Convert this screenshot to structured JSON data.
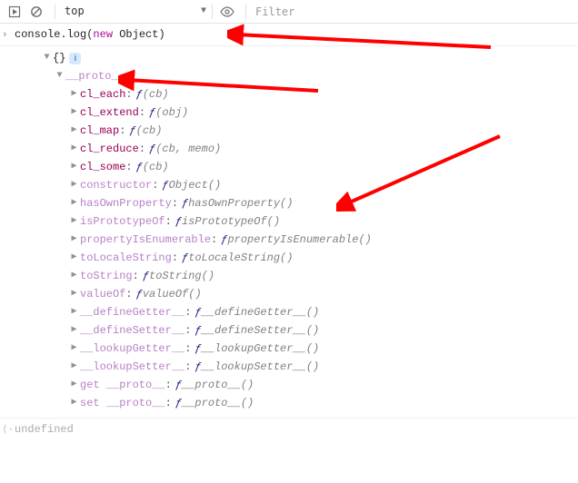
{
  "toolbar": {
    "context": "top",
    "filter_placeholder": "Filter"
  },
  "console": {
    "input_prefix": "console.log(",
    "input_kw": "new",
    "input_suffix": " Object)",
    "result_braces": "{}",
    "info_badge": "i",
    "return_value": "undefined"
  },
  "proto_label": "__proto__",
  "props": [
    {
      "name": "cl_each",
      "sig": "(cb)",
      "faded": false
    },
    {
      "name": "cl_extend",
      "sig": "(obj)",
      "faded": false
    },
    {
      "name": "cl_map",
      "sig": "(cb)",
      "faded": false
    },
    {
      "name": "cl_reduce",
      "sig": "(cb, memo)",
      "faded": false
    },
    {
      "name": "cl_some",
      "sig": "(cb)",
      "faded": false
    },
    {
      "name": "constructor",
      "sig": "Object()",
      "faded": true
    },
    {
      "name": "hasOwnProperty",
      "sig": "hasOwnProperty()",
      "faded": true
    },
    {
      "name": "isPrototypeOf",
      "sig": "isPrototypeOf()",
      "faded": true
    },
    {
      "name": "propertyIsEnumerable",
      "sig": "propertyIsEnumerable()",
      "faded": true
    },
    {
      "name": "toLocaleString",
      "sig": "toLocaleString()",
      "faded": true
    },
    {
      "name": "toString",
      "sig": "toString()",
      "faded": true
    },
    {
      "name": "valueOf",
      "sig": "valueOf()",
      "faded": true
    },
    {
      "name": "__defineGetter__",
      "sig": "__defineGetter__()",
      "faded": true
    },
    {
      "name": "__defineSetter__",
      "sig": "__defineSetter__()",
      "faded": true
    },
    {
      "name": "__lookupGetter__",
      "sig": "__lookupGetter__()",
      "faded": true
    },
    {
      "name": "__lookupSetter__",
      "sig": "__lookupSetter__()",
      "faded": true
    },
    {
      "name": "get __proto__",
      "sig": "__proto__()",
      "faded": true
    },
    {
      "name": "set __proto__",
      "sig": "__proto__()",
      "faded": true
    }
  ],
  "arrows": {
    "color": "#ff0000"
  }
}
